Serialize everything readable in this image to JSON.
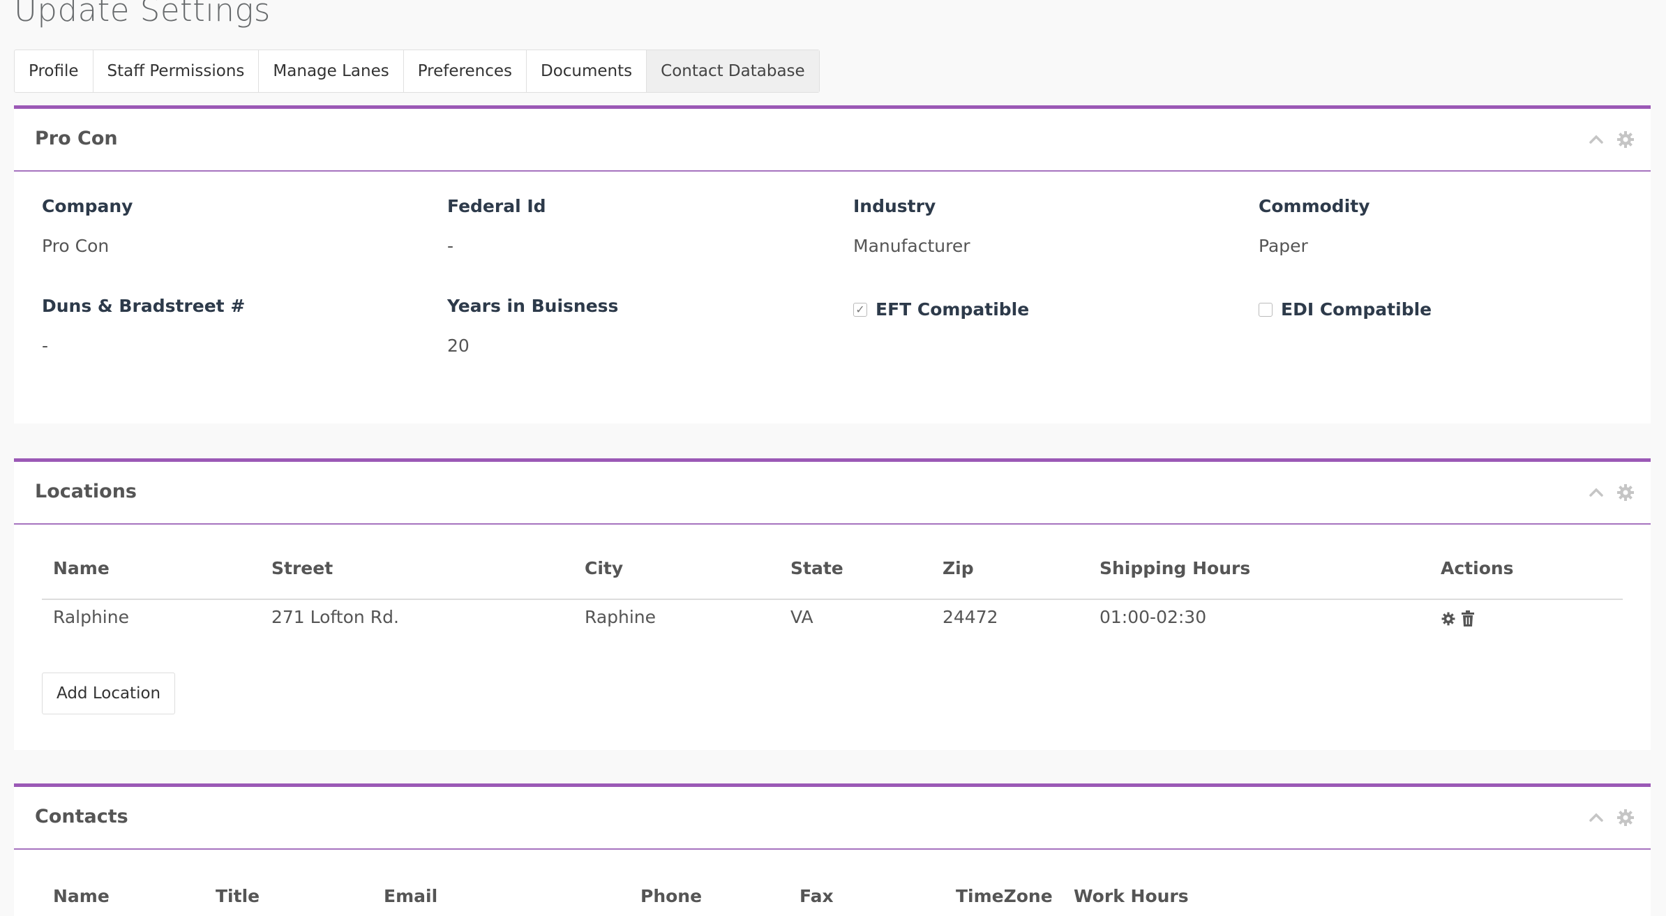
{
  "page": {
    "title": "Update Settings"
  },
  "tabs": [
    {
      "label": "Profile"
    },
    {
      "label": "Staff Permissions"
    },
    {
      "label": "Manage Lanes"
    },
    {
      "label": "Preferences"
    },
    {
      "label": "Documents"
    },
    {
      "label": "Contact Database",
      "active": true
    }
  ],
  "company_panel": {
    "title": "Pro Con",
    "fields": {
      "company": {
        "label": "Company",
        "value": "Pro Con"
      },
      "federal_id": {
        "label": "Federal Id",
        "value": "-"
      },
      "industry": {
        "label": "Industry",
        "value": "Manufacturer"
      },
      "commodity": {
        "label": "Commodity",
        "value": "Paper"
      },
      "duns": {
        "label": "Duns & Bradstreet #",
        "value": "-"
      },
      "years": {
        "label": "Years in Buisness",
        "value": "20"
      }
    },
    "eft": {
      "label": "EFT Compatible",
      "checked": true,
      "mark": "✓"
    },
    "edi": {
      "label": "EDI Compatible",
      "checked": false
    }
  },
  "locations_panel": {
    "title": "Locations",
    "columns": [
      "Name",
      "Street",
      "City",
      "State",
      "Zip",
      "Shipping Hours",
      "Actions"
    ],
    "rows": [
      {
        "name": "Ralphine",
        "street": "271 Lofton Rd.",
        "city": "Raphine",
        "state": "VA",
        "zip": "24472",
        "hours": "01:00-02:30"
      }
    ],
    "add_button": "Add Location"
  },
  "contacts_panel": {
    "title": "Contacts",
    "columns": [
      "Name",
      "Title",
      "Email",
      "Phone",
      "Fax",
      "TimeZone",
      "Work Hours"
    ]
  },
  "colors": {
    "accent": "#9b59b6",
    "panel_rule": "#a673bf"
  },
  "icons": {
    "collapse": "chevron-up-icon",
    "settings": "gear-icon",
    "edit": "gear-icon",
    "delete": "trash-icon"
  }
}
